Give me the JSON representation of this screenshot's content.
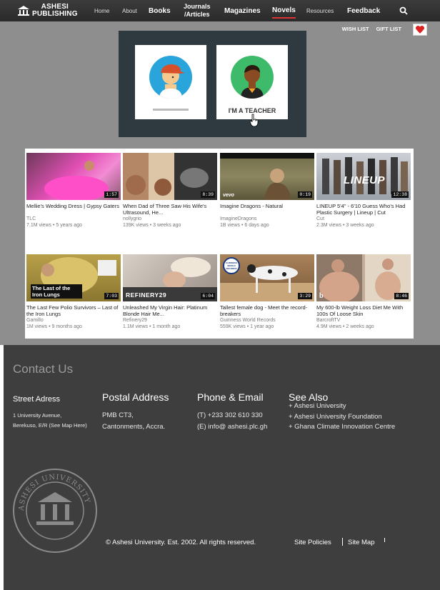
{
  "nav": {
    "logo_line1": "ASHESI",
    "logo_line2": "PUBLISHING",
    "items": [
      "Home",
      "About",
      "Books",
      "Journals",
      "/Articles",
      "Magazines",
      "Novels",
      "Resources",
      "Feedback"
    ]
  },
  "utility": {
    "wishlist": "WISH LIST",
    "giftlist": "GIFT LIST"
  },
  "roles": {
    "teacher_label": "I'M A TEACHER"
  },
  "videos": [
    {
      "title": "Mellie's Wedding Dress | Gypsy Gaters",
      "channel": "TLC",
      "meta": "7.1M views • 5 years ago",
      "duration": "1:57"
    },
    {
      "title": "When Dad of Three Saw His Wife's Ultrasound, He...",
      "channel": "nollygrio",
      "meta": "139K views • 3 weeks ago",
      "duration": "8:39"
    },
    {
      "title": "Imagine Dragons - Natural",
      "channel": "ImagineDragons",
      "meta": "1B views • 6 days ago",
      "duration": "0:19"
    },
    {
      "title": "LINEUP 5'4\" - 6'10 Guess Who's Had Plastic Surgery | Lineup | Cut",
      "channel": "Cut",
      "meta": "2.3M views • 3 weeks ago",
      "duration": "12:38"
    },
    {
      "title": "The Last Few Polio Survivors – Last of the Iron Lungs",
      "channel": "Gamillo",
      "meta": "1M views • 9 months ago",
      "duration": "7:03"
    },
    {
      "title": "Unleashed My Virgin Hair: Platinum Blonde Hair Me...",
      "channel": "Refinery29",
      "meta": "1.1M views • 1 month ago",
      "duration": "6:04"
    },
    {
      "title": "Tallest female dog - Meet the record-breakers",
      "channel": "Guinness World Records",
      "meta": "559K views • 1 year ago",
      "duration": "3:29"
    },
    {
      "title": "My 600-lb Weight Loss Diet Me With 100s Of Loose Skin",
      "channel": "BarcroftTV",
      "meta": "4.9M views • 2 weeks ago",
      "duration": "8:46"
    }
  ],
  "thumb_text": {
    "lineup": "LINEUP",
    "iron_lungs": "The Last of the Iron Lungs",
    "refinery": "REFINERY29",
    "vevo": "vevo",
    "gwr": "GUINNESS WORLD RECORDS",
    "btv": "b"
  },
  "footer": {
    "contact_title": "Contact Us",
    "street_h": "Street Adress",
    "street_lines": [
      "1 University Avenue,",
      "Berekuso, E/R (See Map Here)"
    ],
    "postal_h": "Postal Address",
    "postal_lines": [
      "PMB CT3,",
      "Cantonments, Accra."
    ],
    "phone_h": "Phone & Email",
    "phone_lines": [
      "(T) +233 302 610 330",
      "(E) info@ ashesi.plc.gh"
    ],
    "see_h": "See Also",
    "see_lines": [
      "+ Ashesi University",
      "+ Ashesi University Foundation",
      "+ Ghana Climate Innovation Centre"
    ],
    "seal_text": "ASHESI UNIVERSITY",
    "copyright": "© Ashesi University. Est. 2002.  All rights reserved.",
    "site_policies": "Site Policies",
    "site_map": "Site Map"
  }
}
